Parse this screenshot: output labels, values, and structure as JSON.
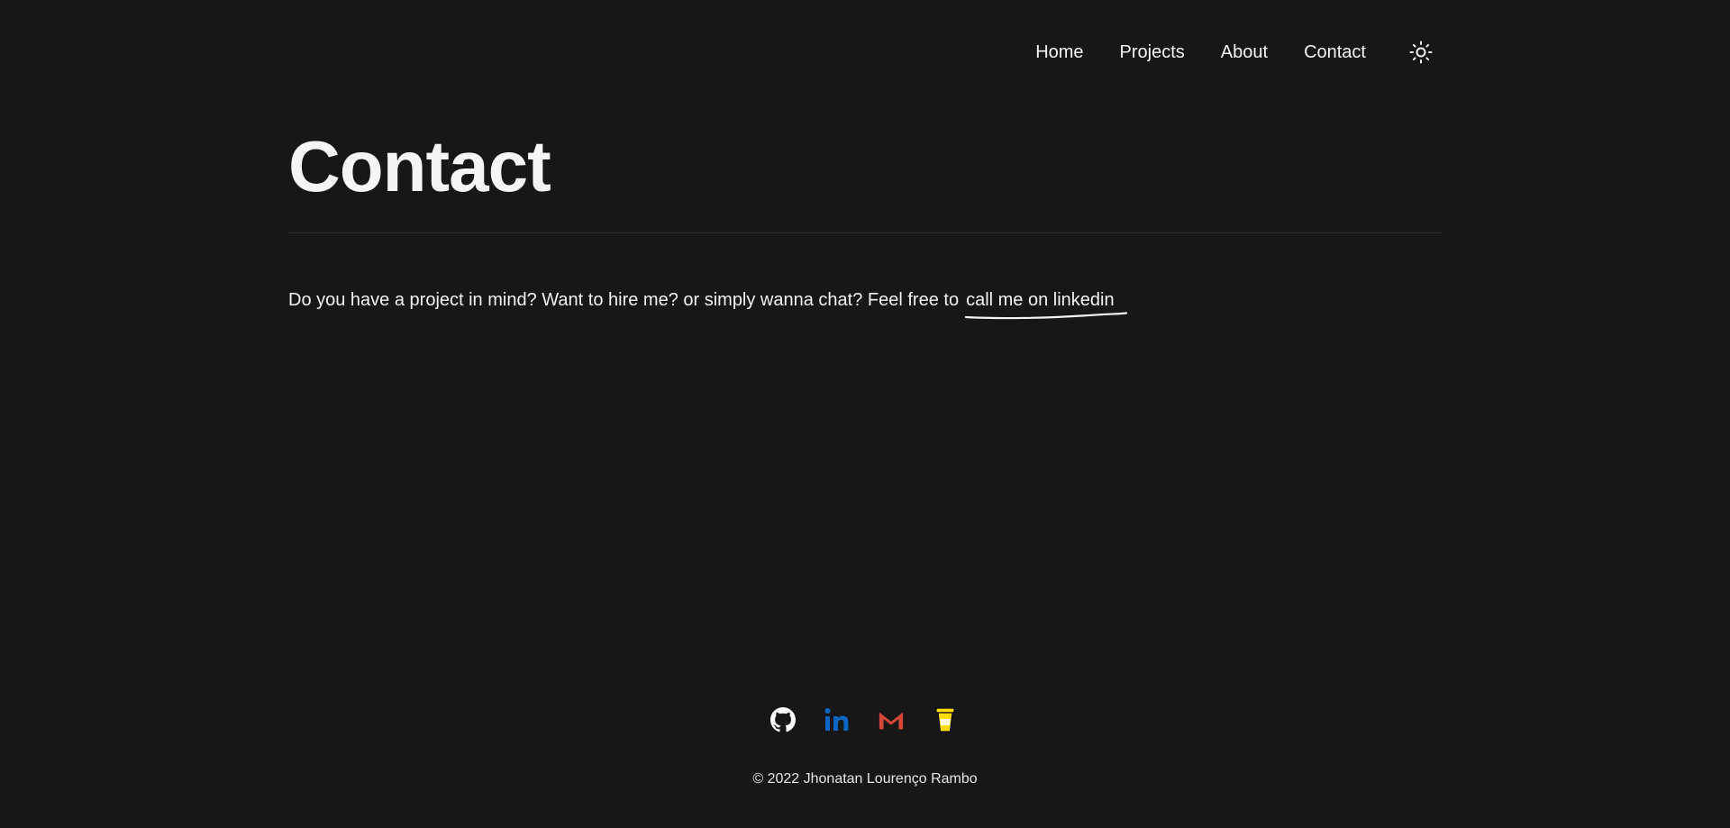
{
  "nav": {
    "items": [
      {
        "label": "Home"
      },
      {
        "label": "Projects"
      },
      {
        "label": "About"
      },
      {
        "label": "Contact"
      }
    ],
    "theme_toggle_icon": "sun-icon"
  },
  "main": {
    "title": "Contact",
    "intro_text": "Do you have a project in mind? Want to hire me? or simply wanna chat? Feel free to",
    "link_text": "call me on linkedin"
  },
  "footer": {
    "socials": [
      {
        "icon": "github-icon",
        "color": "#ffffff"
      },
      {
        "icon": "linkedin-icon",
        "color": "#0a66c2"
      },
      {
        "icon": "gmail-icon",
        "color": "#d44638"
      },
      {
        "icon": "coffee-cup-icon",
        "color": "#ffdd00"
      }
    ],
    "copyright": "© 2022 Jhonatan Lourenço Rambo"
  },
  "colors": {
    "background": "#171717",
    "text": "#f2f2f2",
    "divider": "#2e2e2e"
  }
}
